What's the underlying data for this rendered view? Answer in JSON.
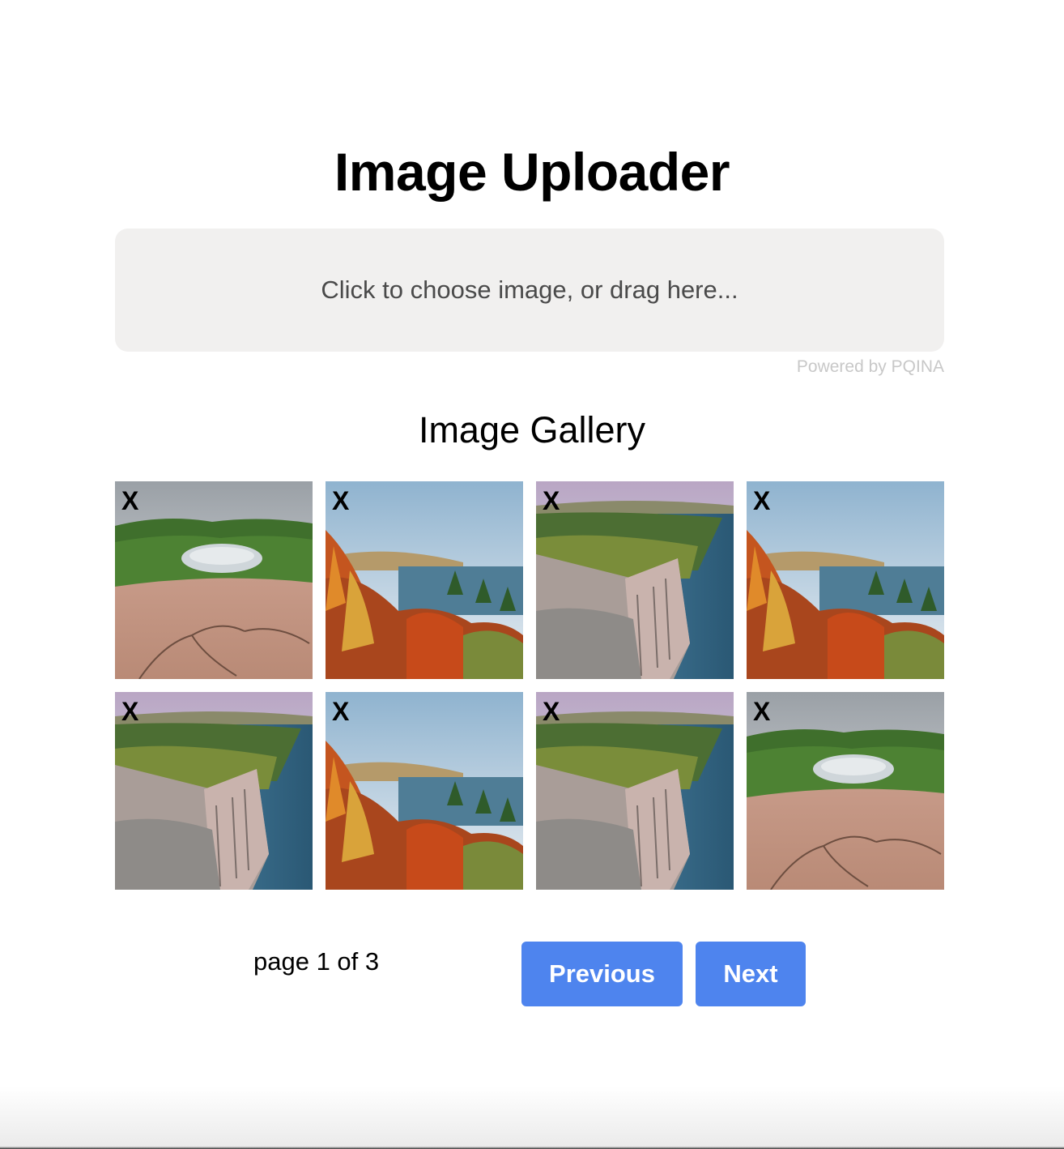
{
  "header": {
    "title": "Image Uploader"
  },
  "uploader": {
    "label": "Click to choose image, or drag here...",
    "credits": "Powered by PQINA"
  },
  "gallery": {
    "title": "Image Gallery",
    "remove_label": "X",
    "images": [
      {
        "scene": "lake-rock"
      },
      {
        "scene": "autumn-forest"
      },
      {
        "scene": "cliff-shore"
      },
      {
        "scene": "autumn-forest"
      },
      {
        "scene": "cliff-shore"
      },
      {
        "scene": "autumn-forest"
      },
      {
        "scene": "cliff-shore"
      },
      {
        "scene": "lake-rock"
      }
    ]
  },
  "pagination": {
    "indicator": "page 1 of 3",
    "previous_label": "Previous",
    "next_label": "Next"
  },
  "colors": {
    "button": "#4e84ee",
    "dropzone": "#f1f0ef",
    "credits": "#c8c8c8"
  }
}
